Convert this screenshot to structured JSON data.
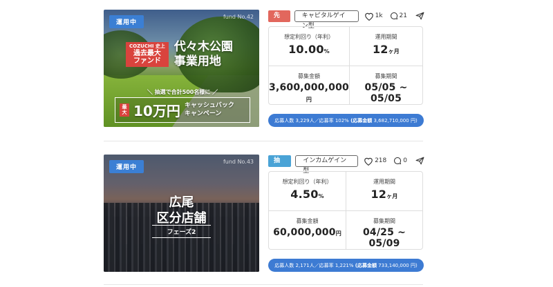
{
  "funds": [
    {
      "status": "運用中",
      "fund_no": "fund No.42",
      "record_label_small": "COZUCHI 史上",
      "record_label_big": "過去最大\nファンド",
      "title": "代々木公園\n事業用地",
      "promo_top": "＼ 抽選で合計500名様に ／",
      "promo_max": "最大",
      "promo_amount": "10万円",
      "promo_text": "キャッシュバック\nキャンペーン",
      "tag": "先着",
      "tag_color": "#e2675d",
      "type": "キャピタルゲイン型",
      "likes": "1k",
      "comments": "21",
      "yield_label": "想定利回り（年利）",
      "yield_value": "10.00",
      "yield_unit": "%",
      "period_label": "運用期間",
      "period_value": "12",
      "period_unit": "ヶ月",
      "amount_label": "募集金額",
      "amount_value": "3,600,000,000",
      "amount_unit": "円",
      "recruit_label": "募集期間",
      "recruit_value": "05/05 ~ 05/05",
      "applicants_label": "応募人数",
      "applicants": "3,229人",
      "rate_label": "応募率",
      "rate": "102%",
      "applied_label": "(応募金額",
      "applied_amount": "3,682,710,000",
      "applied_unit": "円)"
    },
    {
      "status": "運用中",
      "fund_no": "fund No.43",
      "title": "広尾\n区分店舗",
      "phase": "フェーズ2",
      "tag": "抽選",
      "tag_color": "#4aa3d6",
      "type": "インカムゲイン型",
      "likes": "218",
      "comments": "0",
      "yield_label": "想定利回り（年利）",
      "yield_value": "4.50",
      "yield_unit": "%",
      "period_label": "運用期間",
      "period_value": "12",
      "period_unit": "ヶ月",
      "amount_label": "募集金額",
      "amount_value": "60,000,000",
      "amount_unit": "円",
      "recruit_label": "募集期間",
      "recruit_value": "04/25 ~ 05/09",
      "applicants_label": "応募人数",
      "applicants": "2,171人",
      "rate_label": "応募率",
      "rate": "1,221%",
      "applied_label": "(応募金額",
      "applied_amount": "733,140,000",
      "applied_unit": "円)"
    }
  ],
  "colors": {
    "status_blue": "#3b7fd4",
    "appbar_blue": "#3d7bd3",
    "record_red": "#d9433d"
  },
  "icons": {
    "like": "heart-icon",
    "comment": "comment-icon",
    "share": "share-icon"
  }
}
